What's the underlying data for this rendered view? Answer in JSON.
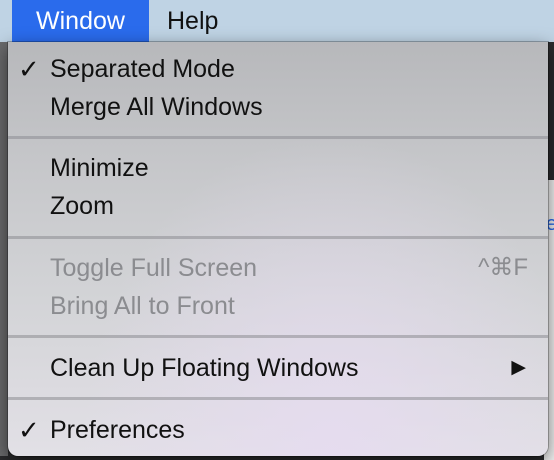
{
  "menubar": {
    "items": [
      {
        "label": "Window",
        "active": true
      },
      {
        "label": "Help",
        "active": false
      }
    ],
    "active_color": "#2a6bec"
  },
  "dropdown": {
    "items": [
      {
        "label": "Separated Mode",
        "checked": true,
        "enabled": true
      },
      {
        "label": "Merge All Windows",
        "checked": false,
        "enabled": true
      },
      {
        "label": "Minimize",
        "enabled": true
      },
      {
        "label": "Zoom",
        "enabled": true
      },
      {
        "label": "Toggle Full Screen",
        "shortcut": "^⌘F",
        "enabled": false
      },
      {
        "label": "Bring All to Front",
        "enabled": false
      },
      {
        "label": "Clean Up Floating Windows",
        "has_submenu": true,
        "enabled": true
      },
      {
        "label": "Preferences",
        "checked": true,
        "enabled": true
      }
    ],
    "check_glyph": "✓",
    "submenu_glyph": "▶"
  }
}
